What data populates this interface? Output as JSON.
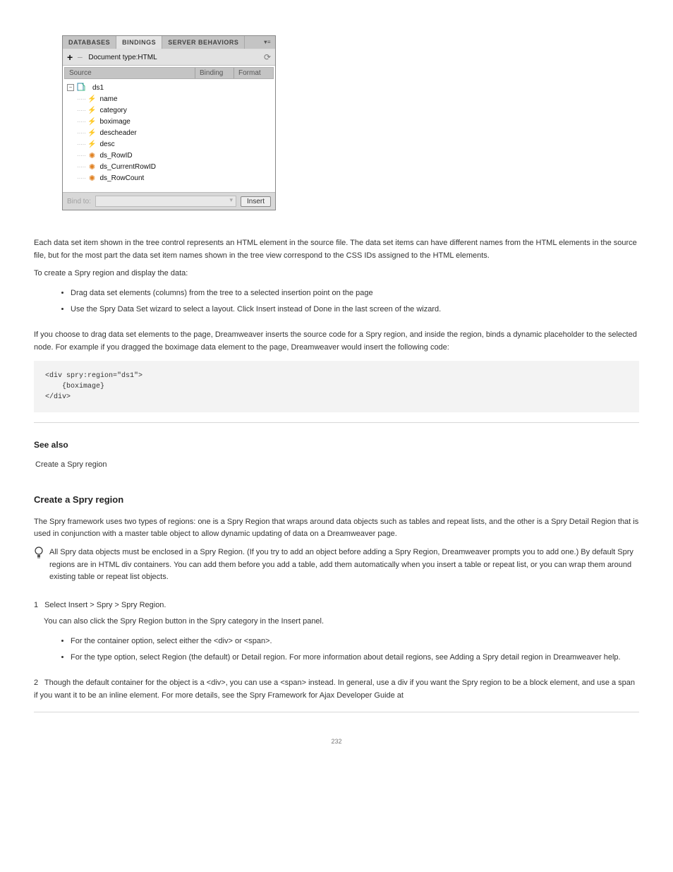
{
  "panel": {
    "tabs": {
      "db": "DATABASES",
      "bind": "BINDINGS",
      "serverBehaviors": "SERVER BEHAVIORS"
    },
    "menuGlyph": "▾≡",
    "toolbar": {
      "plus": "+",
      "minus": "−",
      "docType": "Document type:HTML",
      "refresh": "⟳"
    },
    "columns": {
      "source": "Source",
      "binding": "Binding",
      "format": "Format"
    },
    "tree": {
      "collapseGlyph": "−",
      "dsName": "ds1",
      "items": [
        {
          "type": "field",
          "label": "name"
        },
        {
          "type": "field",
          "label": "category"
        },
        {
          "type": "field",
          "label": "boximage"
        },
        {
          "type": "field",
          "label": "descheader"
        },
        {
          "type": "field",
          "label": "desc"
        },
        {
          "type": "builtin",
          "label": "ds_RowID"
        },
        {
          "type": "builtin",
          "label": "ds_CurrentRowID"
        },
        {
          "type": "builtin",
          "label": "ds_RowCount"
        }
      ]
    },
    "footer": {
      "bindTo": "Bind to:",
      "insert": "Insert"
    }
  },
  "p1": "Each data set item shown in the tree control represents an HTML element in the source file. The data set items can have different names from the HTML elements in the source file, but for the most part the data set item names shown in the tree view correspond to the CSS IDs assigned to the HTML elements.",
  "p2": "To create a Spry region and display the data:",
  "bullets1": [
    "Drag data set elements (columns) from the tree to a selected insertion point on the page",
    "Use the Spry Data Set wizard to select a layout. Click Insert instead of Done in the last screen of the wizard."
  ],
  "p3": "If you choose to drag data set elements to the page, Dreamweaver inserts the source code for a Spry region, and inside the region, binds a dynamic placeholder to the selected node. For example if you dragged the boximage data element to the page, Dreamweaver would insert the following code:",
  "code": "<div spry:region=\"ds1\">\n    {boximage}\n</div>",
  "seealsoHead": "See also",
  "seealso": "Create a Spry region",
  "topicTitle": "Create a Spry region",
  "topicP1": "The Spry framework uses two types of regions: one is a Spry Region that wraps around data objects such as tables and repeat lists, and the other is a Spry Detail Region that is used in conjunction with a master table object to allow dynamic updating of data on a Dreamweaver page.",
  "tipText": "All Spry data objects must be enclosed in a Spry Region. (If you try to add an object before adding a Spry Region, Dreamweaver prompts you to add one.) By default Spry regions are in HTML div containers. You can add them before you add a table, add them automatically when you insert a table or repeat list, or you can wrap them around existing table or repeat list objects.",
  "step1": {
    "num": "1",
    "text": "Select Insert > Spry > Spry Region.",
    "alt": "You can also click the Spry Region button in the Spry category in the Insert panel."
  },
  "step2": {
    "num": "2",
    "text": "Though the default container for the object is a <div>, you can use a <span> instead. In general, use a div if you want the Spry region to be a block element, and use a span if you want it to be an inline element. For more details, see the Spry Framework for Ajax Developer Guide at"
  },
  "bullets2": [
    "For the container option, select either the <div> or <span>.",
    "For the type option, select Region (the default) or Detail region. For more information about detail regions, see Adding a Spry detail region in Dreamweaver help."
  ],
  "pageNum": "232"
}
